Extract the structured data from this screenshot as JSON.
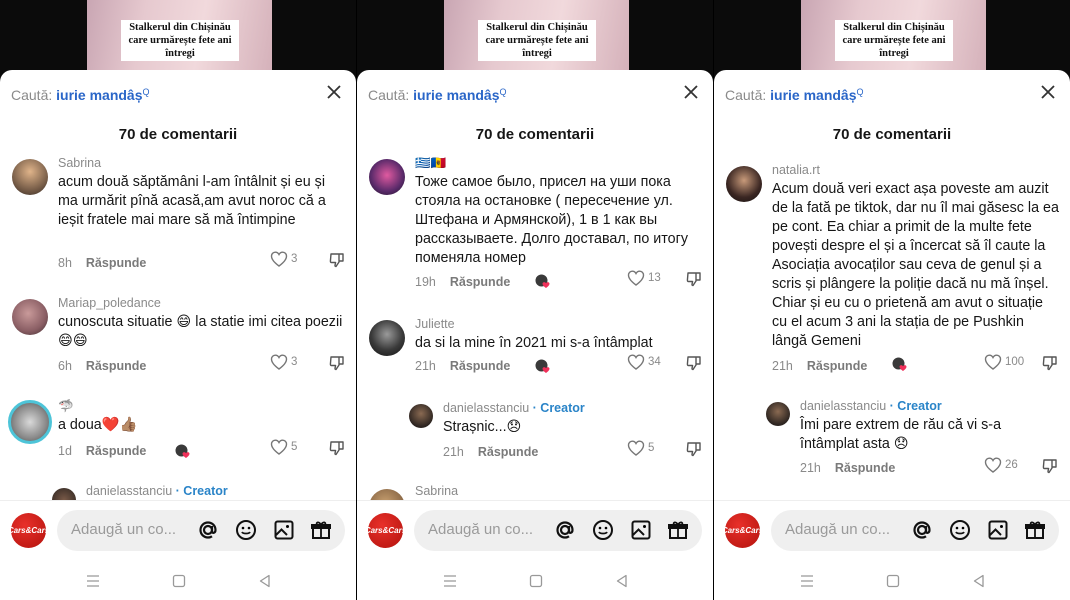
{
  "video_caption": "Stalkerul din Chișinău care urmărește fete ani întregi",
  "search": {
    "label": "Caută:",
    "query": "iurie mandâș",
    "sup": "Q"
  },
  "comment_count": "70 de comentarii",
  "reply_label": "Răspunde",
  "creator_label": "· Creator",
  "input_placeholder": "Adaugă un co...",
  "logo_text": "Cars&Cars",
  "icons": {
    "close": "close-icon",
    "mention": "at-icon",
    "emoji": "emoji-icon",
    "image": "image-icon",
    "gift": "gift-icon",
    "like": "heart-outline-icon",
    "dislike": "thumbs-down-icon",
    "creator_liked": "creator-liked-icon",
    "nav": [
      "menu-icon",
      "home-icon",
      "back-icon"
    ]
  },
  "panels": [
    {
      "comments": [
        {
          "user": "Sabrina",
          "text": "acum două săptămâni l-am întâlnit și eu și ma urmărit pînă acasă,am avut noroc că a ieșit fratele mai mare să mă întimpine",
          "time": "8h",
          "likes": "3"
        },
        {
          "user": "Mariap_poledance",
          "text": "cunoscuta situatie 😄 la statie imi citea poezii 😄😄",
          "time": "6h",
          "likes": "3"
        },
        {
          "user": "🦈",
          "text": "a doua❤️👍🏽",
          "time": "1d",
          "likes": "5"
        },
        {
          "user": "danielasstanciu",
          "text": "",
          "time": "",
          "likes": ""
        }
      ]
    },
    {
      "comments": [
        {
          "user": "🇬🇷🇲🇩",
          "text": "Тоже самое было, присел на уши пока стояла на остановке ( пересечение ул. Штефана и Армянской), 1 в 1 как вы рассказываете. Долго доставал, по итогу поменяла номер",
          "time": "19h",
          "likes": "13"
        },
        {
          "user": "Juliette",
          "text": "da si la mine în 2021 mi s-a întâmplat",
          "time": "21h",
          "likes": "34"
        },
        {
          "user": "danielasstanciu",
          "text": "Strașnic...😞",
          "time": "21h",
          "likes": "5"
        },
        {
          "user": "Sabrina",
          "text": "",
          "time": "",
          "likes": ""
        }
      ]
    },
    {
      "comments": [
        {
          "user": "natalia.rt",
          "text": "Acum două veri exact așa poveste am auzit de la fată pe tiktok, dar nu îl mai găsesc la ea pe cont. Ea chiar a primit de la multe fete povești despre el și a încercat să îl caute la Asociația avocaților sau ceva de genul și a scris și plângere la poliție dacă nu mă înșel. Chiar și eu cu o prietenă am avut o situație cu el acum 3 ani la stația de pe Pushkin lângă Gemeni",
          "time": "21h",
          "likes": "100"
        },
        {
          "user": "danielasstanciu",
          "text": "Îmi pare extrem de rău că vi s-a întâmplat asta 😞",
          "time": "21h",
          "likes": "26"
        }
      ]
    }
  ]
}
